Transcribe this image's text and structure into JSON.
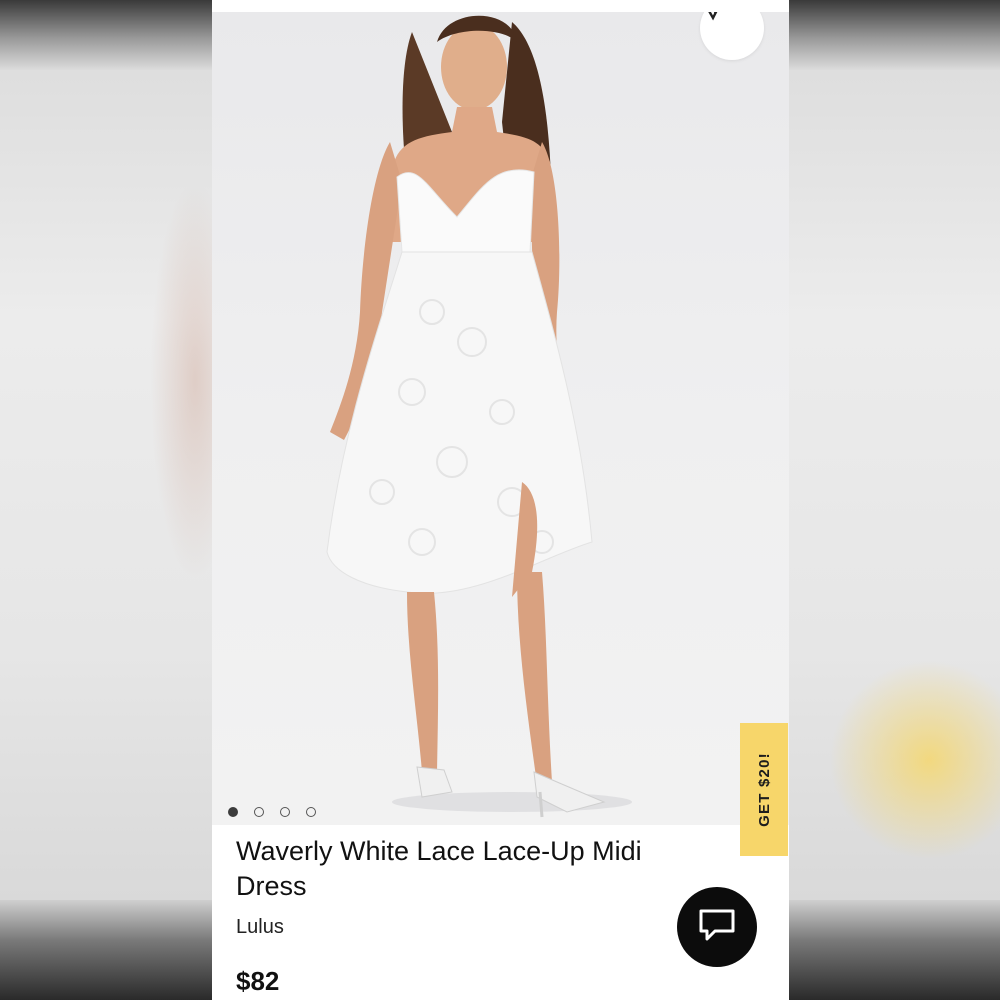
{
  "product": {
    "title": "Waverly White Lace Lace-Up Midi Dress",
    "brand": "Lulus",
    "price": "$82"
  },
  "carousel": {
    "total_images": 4,
    "active_index": 0
  },
  "promo_tab": {
    "label": "GET $20!",
    "color": "#f7d66a"
  },
  "icons": {
    "logo": "poshmark-logo-icon",
    "chat": "chat-bubble-icon"
  },
  "colors": {
    "chat_button": "#0c0c0c",
    "background": "#ffffff"
  }
}
